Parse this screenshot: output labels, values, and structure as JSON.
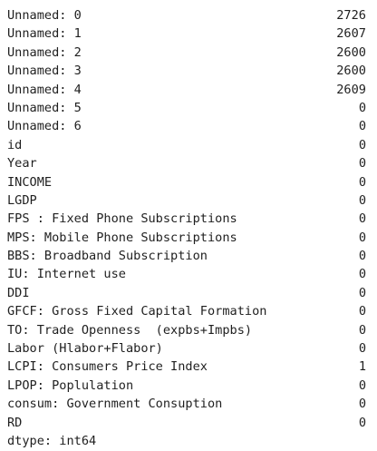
{
  "series_output": {
    "rows": [
      {
        "label": "Unnamed: 0",
        "value": "2726"
      },
      {
        "label": "Unnamed: 1",
        "value": "2607"
      },
      {
        "label": "Unnamed: 2",
        "value": "2600"
      },
      {
        "label": "Unnamed: 3",
        "value": "2600"
      },
      {
        "label": "Unnamed: 4",
        "value": "2609"
      },
      {
        "label": "Unnamed: 5",
        "value": "0"
      },
      {
        "label": "Unnamed: 6",
        "value": "0"
      },
      {
        "label": "id",
        "value": "0"
      },
      {
        "label": "Year",
        "value": "0"
      },
      {
        "label": "INCOME",
        "value": "0"
      },
      {
        "label": "LGDP",
        "value": "0"
      },
      {
        "label": "FPS : Fixed Phone Subscriptions",
        "value": "0"
      },
      {
        "label": "MPS: Mobile Phone Subscriptions",
        "value": "0"
      },
      {
        "label": "BBS: Broadband Subscription",
        "value": "0"
      },
      {
        "label": "IU: Internet use",
        "value": "0"
      },
      {
        "label": "DDI",
        "value": "0"
      },
      {
        "label": "GFCF: Gross Fixed Capital Formation",
        "value": "0"
      },
      {
        "label": "TO: Trade Openness  (expbs+Impbs)",
        "value": "0"
      },
      {
        "label": "Labor (Hlabor+Flabor)",
        "value": "0"
      },
      {
        "label": "LCPI: Consumers Price Index",
        "value": "1"
      },
      {
        "label": "LPOP: Poplulation",
        "value": "0"
      },
      {
        "label": "consum: Government Consuption",
        "value": "0"
      },
      {
        "label": "RD",
        "value": "0"
      }
    ],
    "dtype_line": "dtype: int64"
  }
}
